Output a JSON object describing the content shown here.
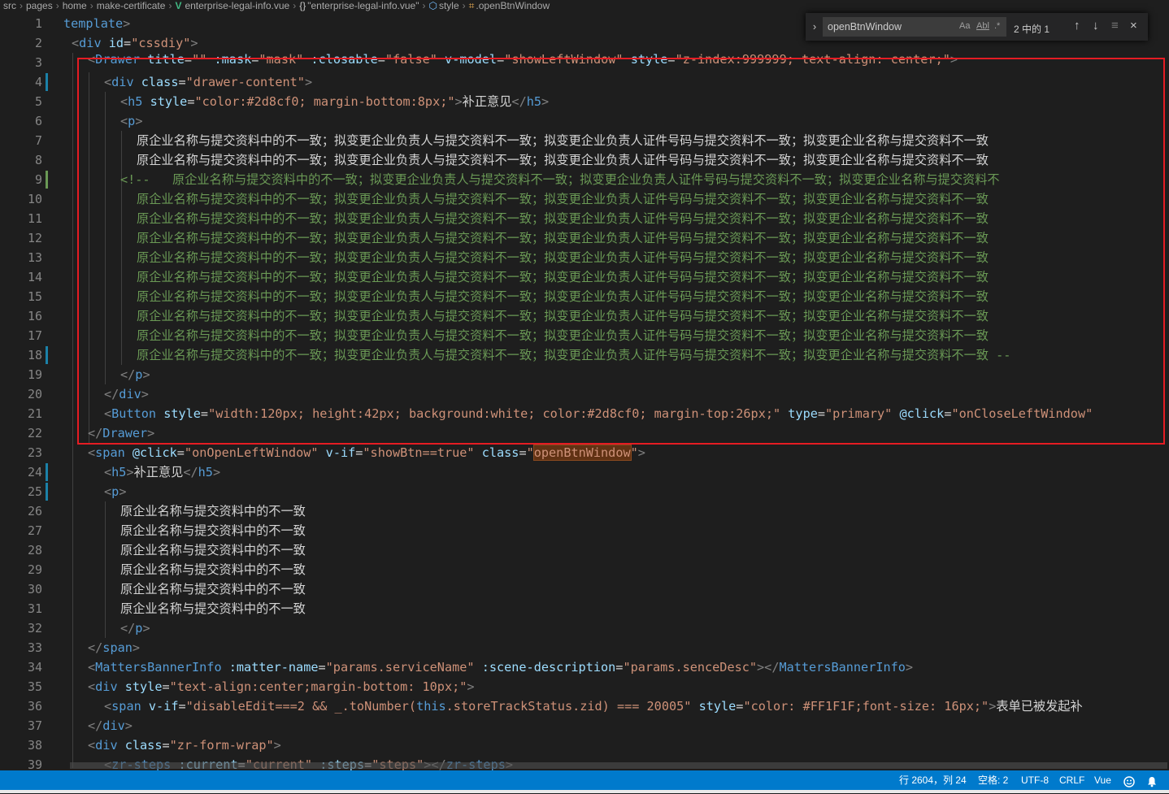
{
  "breadcrumb": {
    "items": [
      "src",
      "pages",
      "home",
      "make-certificate",
      "enterprise-legal-info.vue",
      "\"enterprise-legal-info.vue\"",
      "style",
      ".openBtnWindow"
    ]
  },
  "find_widget": {
    "query": "openBtnWindow",
    "match_case": "Aa",
    "whole_word": "Abl",
    "regex": ".*",
    "count": "2 中的 1",
    "prev": "↑",
    "next": "↓",
    "in_selection": "≡",
    "close": "×"
  },
  "editor": {
    "line_numbers": [
      "1",
      "2",
      "3",
      "4",
      "5",
      "6",
      "7",
      "8",
      "9",
      "10",
      "11",
      "12",
      "13",
      "14",
      "15",
      "16",
      "17",
      "18",
      "19",
      "20",
      "21",
      "22",
      "23",
      "24",
      "25",
      "26",
      "27",
      "28",
      "29",
      "30",
      "31",
      "32",
      "33",
      "34",
      "35",
      "36",
      "37",
      "38",
      "39"
    ],
    "text": {
      "template": "template",
      "div": "div",
      "id_attr": "id",
      "cssdiy": "\"cssdiy\"",
      "drawer": "Drawer",
      "title_attr": "title",
      "empty_str": "\"\"",
      "mask_attr": ":mask",
      "mask_val": "\"mask\"",
      "closable_attr": ":closable",
      "false_val": "\"false\"",
      "vmodel_attr": "v-model",
      "vmodel_val": "\"showLeftWindow\"",
      "style_attr": "style",
      "drawer_style": "\"z-index:999999; text-align: center;\"",
      "class_attr": "class",
      "drawer_content": "\"drawer-content\"",
      "h5": "h5",
      "h5_style": "\"color:#2d8cf0; margin-bottom:8px;\"",
      "h5_text": "补正意见",
      "p": "p",
      "long_text": "原企业名称与提交资料中的不一致；拟变更企业负责人与提交资料不一致；拟变更企业负责人证件号码与提交资料不一致；拟变更企业名称与提交资料不一致",
      "comment_open": "<!--",
      "comment_text": "原企业名称与提交资料中的不一致；拟变更企业负责人与提交资料不一致；拟变更企业负责人证件号码与提交资料不一致；拟变更企业名称与提交资料不",
      "comment_last_tail": " --",
      "button": "Button",
      "button_style": "\"width:120px; height:42px; background:white; color:#2d8cf0; margin-top:26px;\"",
      "type_attr": "type",
      "primary": "\"primary\"",
      "click_attr": "@click",
      "on_close": "\"onCloseLeftWindow\"",
      "span": "span",
      "on_open": "\"onOpenLeftWindow\"",
      "vif_attr": "v-if",
      "show_btn": "\"showBtn==true\"",
      "quote": "\"",
      "open_btn_window": "openBtnWindow",
      "short_text": "原企业名称与提交资料中的不一致",
      "matters": "MattersBannerInfo",
      "matter_name_attr": ":matter-name",
      "matter_name_val": "\"params.serviceName\"",
      "scene_attr": ":scene-description",
      "scene_val": "\"params.senceDesc\"",
      "div35_style": "\"text-align:center;margin-bottom: 10px;\"",
      "vif_expr_a": "\"disableEdit===2 && _.toNumber(",
      "this_kw": "this",
      "vif_expr_b": ".storeTrackStatus.zid) === 20005\"",
      "span36_style": "\"color: #FF1F1F;font-size: 16px;\"",
      "span36_text": "表单已被发起补",
      "zr_form_wrap": "\"zr-form-wrap\"",
      "zr_steps": "zr-steps",
      "current_attr": ":current",
      "current_val": "\"current\"",
      "steps_attr": ":steps",
      "steps_val": "\"steps\""
    }
  },
  "status_bar": {
    "position": "行 2604，列 24",
    "indent": "空格: 2",
    "encoding": "UTF-8",
    "eol": "CRLF",
    "language": "Vue",
    "feedback_icon": "smiley-icon",
    "bell_icon": "bell-icon"
  }
}
